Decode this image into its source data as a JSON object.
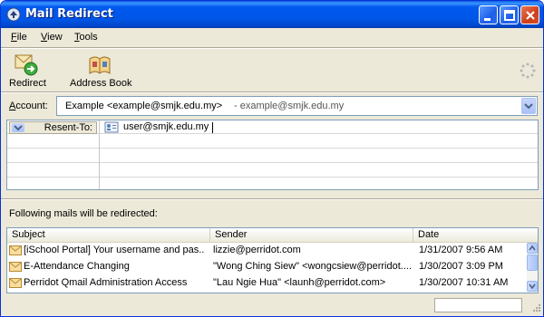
{
  "window": {
    "title": "Mail Redirect"
  },
  "menu": [
    {
      "key": "F",
      "rest": "ile"
    },
    {
      "key": "V",
      "rest": "iew"
    },
    {
      "key": "T",
      "rest": "ools"
    }
  ],
  "toolbar": {
    "redirect": "Redirect",
    "address_book": "Address Book"
  },
  "account": {
    "label_key": "A",
    "label_rest": "ccount:",
    "selected": "Example <example@smjk.edu.my>",
    "identity": "- example@smjk.edu.my"
  },
  "recipients": [
    {
      "type": "Resent-To:",
      "address": "user@smjk.edu.my"
    }
  ],
  "following_text": "Following mails will be redirected:",
  "list": {
    "columns": [
      "Subject",
      "Sender",
      "Date"
    ],
    "rows": [
      {
        "subject": "[iSchool Portal] Your username and pas...",
        "sender": "lizzie@perridot.com",
        "date": "1/31/2007 9:56 AM"
      },
      {
        "subject": "E-Attendance Changing",
        "sender": "\"Wong Ching Siew\" <wongcsiew@perridot....",
        "date": "1/30/2007 3:09 PM"
      },
      {
        "subject": "Perridot Qmail Administration Access",
        "sender": "\"Lau Ngie Hua\" <launh@perridot.com>",
        "date": "1/30/2007 10:31 AM"
      }
    ]
  },
  "colors": {
    "titlebar": "#0055e5",
    "chrome": "#ece9d8",
    "border": "#7f9db9"
  }
}
